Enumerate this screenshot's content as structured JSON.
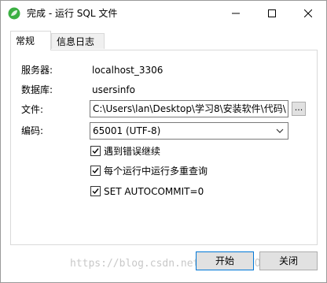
{
  "window": {
    "title": "完成 - 运行 SQL 文件",
    "controls": {
      "minimize_icon": "minimize-icon",
      "maximize_icon": "maximize-icon",
      "close_icon": "close-icon"
    }
  },
  "tabs": [
    {
      "label": "常规",
      "active": true
    },
    {
      "label": "信息日志",
      "active": false
    }
  ],
  "form": {
    "server_label": "服务器:",
    "server_value": "localhost_3306",
    "database_label": "数据库:",
    "database_value": "usersinfo",
    "file_label": "文件:",
    "file_value": "C:\\Users\\lan\\Desktop\\学习8\\安装软件\\代码\\",
    "browse_label": "...",
    "encoding_label": "编码:",
    "encoding_value": "65001 (UTF-8)"
  },
  "options": [
    {
      "label": "遇到错误继续",
      "checked": true
    },
    {
      "label": "每个运行中运行多重查询",
      "checked": true
    },
    {
      "label": "SET AUTOCOMMIT=0",
      "checked": true
    }
  ],
  "buttons": {
    "start": "开始",
    "close": "关闭"
  },
  "watermark": "https://blog.csdn.net/...@51CTO博客",
  "colors": {
    "app_icon": "#3cb043",
    "focus_border": "#0078d7"
  }
}
